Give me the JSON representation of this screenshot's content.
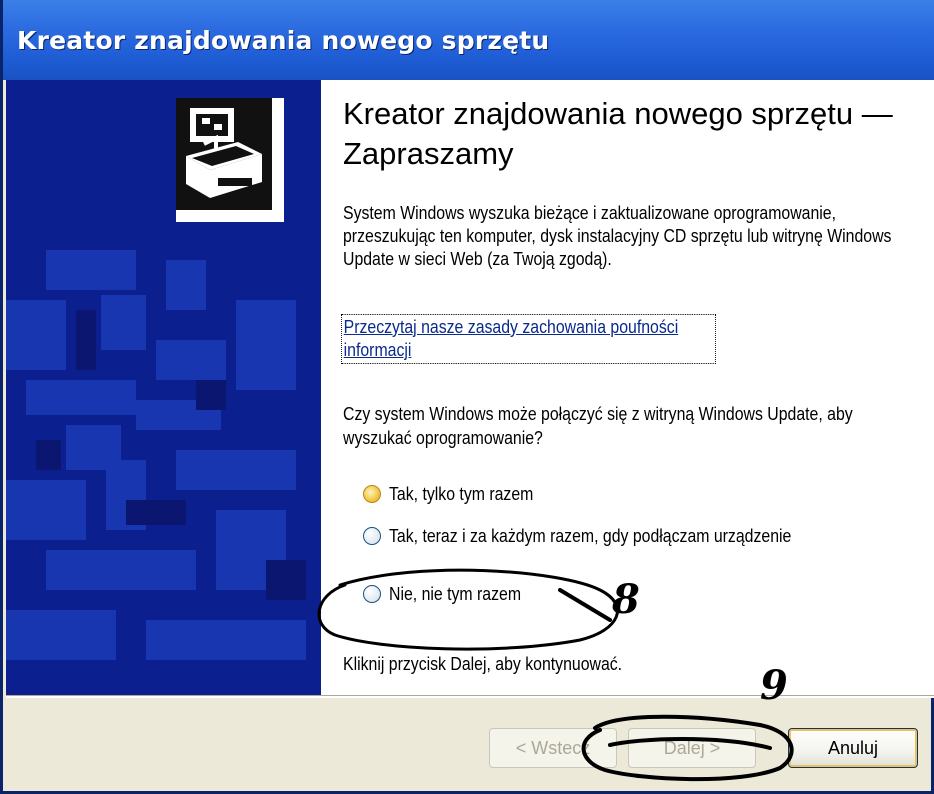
{
  "window": {
    "title": "Kreator znajdowania nowego sprzętu"
  },
  "content": {
    "heading": "Kreator znajdowania nowego sprzętu — Zapraszamy",
    "paragraph": "System Windows wyszuka bieżące i zaktualizowane oprogramowanie, przeszukując ten komputer, dysk instalacyjny CD sprzętu lub witrynę Windows Update w sieci Web (za Twoją zgodą).",
    "privacy_link": "Przeczytaj nasze zasady zachowania poufności informacji",
    "question": "Czy system Windows może połączyć się z witryną Windows Update, aby wyszukać oprogramowanie?",
    "options": [
      {
        "label": "Tak, tylko tym razem",
        "checked": true
      },
      {
        "label": "Tak, teraz i za każdym razem, gdy podłączam urządzenie",
        "checked": false
      },
      {
        "label": "Nie, nie tym razem",
        "checked": false
      }
    ],
    "continue_text": "Kliknij przycisk Dalej, aby kontynuować."
  },
  "buttons": {
    "back": "< Wstecz",
    "next": "Dalej >",
    "cancel": "Anuluj"
  },
  "annotations": {
    "marker_1": "8",
    "marker_2": "9"
  },
  "colors": {
    "titlebar": "#2c6ce0",
    "sidepanel": "#0c1f8e",
    "radio_checked": "#f2c94c"
  }
}
